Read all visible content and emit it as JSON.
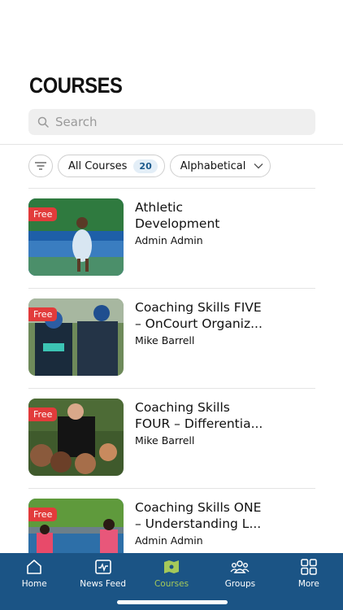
{
  "page": {
    "title": "COURSES"
  },
  "search": {
    "placeholder": "Search"
  },
  "filters": {
    "all_courses_label": "All Courses",
    "all_courses_count": "20",
    "sort_label": "Alphabetical"
  },
  "courses": [
    {
      "badge": "Free",
      "name": "Athletic\nDevelopment",
      "author": "Admin Admin"
    },
    {
      "badge": "Free",
      "name": "Coaching Skills FIVE\n– OnCourt Organiz...",
      "author": "Mike Barrell"
    },
    {
      "badge": "Free",
      "name": "Coaching Skills\nFOUR – Differentia...",
      "author": "Mike Barrell"
    },
    {
      "badge": "Free",
      "name": "Coaching Skills ONE\n– Understanding L...",
      "author": "Admin Admin"
    }
  ],
  "tabbar": {
    "items": [
      {
        "label": "Home",
        "icon": "home-icon"
      },
      {
        "label": "News Feed",
        "icon": "news-feed-icon"
      },
      {
        "label": "Courses",
        "icon": "courses-icon"
      },
      {
        "label": "Groups",
        "icon": "groups-icon"
      },
      {
        "label": "More",
        "icon": "grid-icon"
      }
    ],
    "active_index": 2,
    "active_color": "#a5c95a",
    "background": "#1b5485"
  },
  "colors": {
    "badge": "#e23b3b",
    "accent": "#1b5485"
  }
}
